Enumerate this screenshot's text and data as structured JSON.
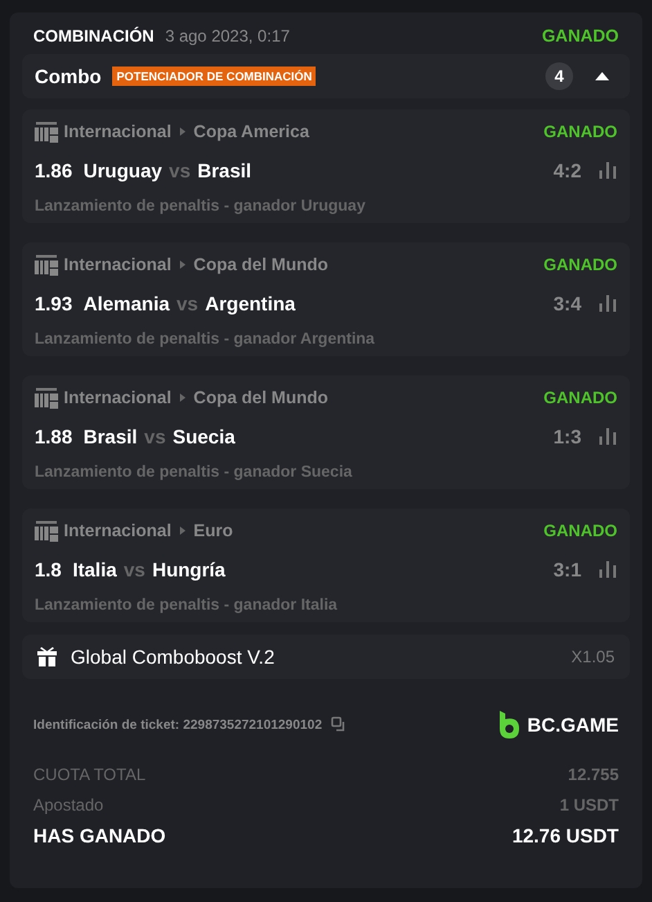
{
  "header": {
    "title": "COMBINACIÓN",
    "date": "3 ago 2023, 0:17",
    "status": "GANADO"
  },
  "combo": {
    "label": "Combo",
    "badge": "POTENCIADOR DE COMBINACIÓN",
    "count": "4",
    "expanded": true
  },
  "legs": [
    {
      "category": "Internacional",
      "tournament": "Copa America",
      "status": "GANADO",
      "odds": "1.86",
      "home": "Uruguay",
      "vs": "vs",
      "away": "Brasil",
      "score": "4:2",
      "market": "Lanzamiento de penaltis - ganador Uruguay"
    },
    {
      "category": "Internacional",
      "tournament": "Copa del Mundo",
      "status": "GANADO",
      "odds": "1.93",
      "home": "Alemania",
      "vs": "vs",
      "away": "Argentina",
      "score": "3:4",
      "market": "Lanzamiento de penaltis - ganador Argentina"
    },
    {
      "category": "Internacional",
      "tournament": "Copa del Mundo",
      "status": "GANADO",
      "odds": "1.88",
      "home": "Brasil",
      "vs": "vs",
      "away": "Suecia",
      "score": "1:3",
      "market": "Lanzamiento de penaltis - ganador Suecia"
    },
    {
      "category": "Internacional",
      "tournament": "Euro",
      "status": "GANADO",
      "odds": "1.8",
      "home": "Italia",
      "vs": "vs",
      "away": "Hungría",
      "score": "3:1",
      "market": "Lanzamiento de penaltis - ganador Italia"
    }
  ],
  "boost": {
    "name": "Global Comboboost V.2",
    "multiplier": "X1.05"
  },
  "ticket": {
    "label": "Identificación de ticket: 2298735272101290102",
    "brand": "BC.GAME"
  },
  "summary": [
    {
      "kind": "muted",
      "label": "CUOTA TOTAL",
      "value": "12.755"
    },
    {
      "kind": "muted",
      "label": "Apostado",
      "value": "1 USDT"
    },
    {
      "kind": "total",
      "label": "HAS GANADO",
      "value": "12.76 USDT"
    }
  ]
}
